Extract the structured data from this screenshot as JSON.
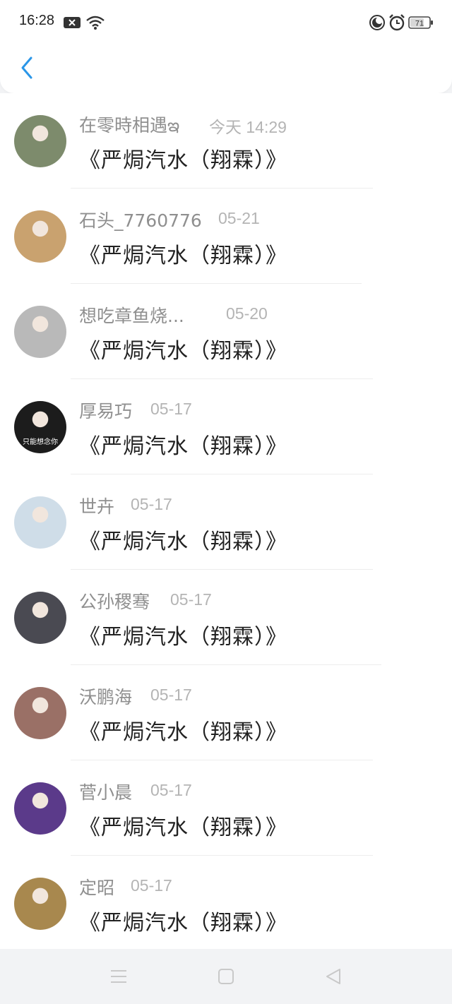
{
  "status": {
    "time": "16:28",
    "battery": "71",
    "icons": [
      "notification-x-icon",
      "wifi-icon",
      "do-not-disturb-icon",
      "alarm-icon",
      "battery-icon"
    ]
  },
  "header": {
    "back_icon": "chevron-left-icon",
    "accent": "#2a96e8"
  },
  "items": [
    {
      "name": "在零時相遇ఇ",
      "date": "今天 14:29",
      "message": "《严焗汽水（翔霖）》",
      "avatar_color": "#7d8b6c"
    },
    {
      "name": "石头_7760776",
      "date": "05-21",
      "message": "《严焗汽水（翔霖）》",
      "avatar_color": "#c9a26f"
    },
    {
      "name": "想吃章鱼烧...",
      "date": "05-20",
      "message": "《严焗汽水（翔霖）》",
      "avatar_color": "#b9b9b9"
    },
    {
      "name": "厚易巧",
      "date": "05-17",
      "message": "《严焗汽水（翔霖）》",
      "avatar_color": "#1c1c1c",
      "avatar_caption": "只能想念你"
    },
    {
      "name": "世卉",
      "date": "05-17",
      "message": "《严焗汽水（翔霖）》",
      "avatar_color": "#cfdde8"
    },
    {
      "name": "公孙稷骞",
      "date": "05-17",
      "message": "《严焗汽水（翔霖）》",
      "avatar_color": "#4a4a52"
    },
    {
      "name": "沃鹏海",
      "date": "05-17",
      "message": "《严焗汽水（翔霖）》",
      "avatar_color": "#9a7066"
    },
    {
      "name": "菅小晨",
      "date": "05-17",
      "message": "《严焗汽水（翔霖）》",
      "avatar_color": "#5b3a8a"
    },
    {
      "name": "定昭",
      "date": "05-17",
      "message": "《严焗汽水（翔霖）》",
      "avatar_color": "#a8884e"
    }
  ],
  "navbar": {
    "icons": [
      "menu-icon",
      "home-square-icon",
      "back-triangle-icon"
    ]
  }
}
